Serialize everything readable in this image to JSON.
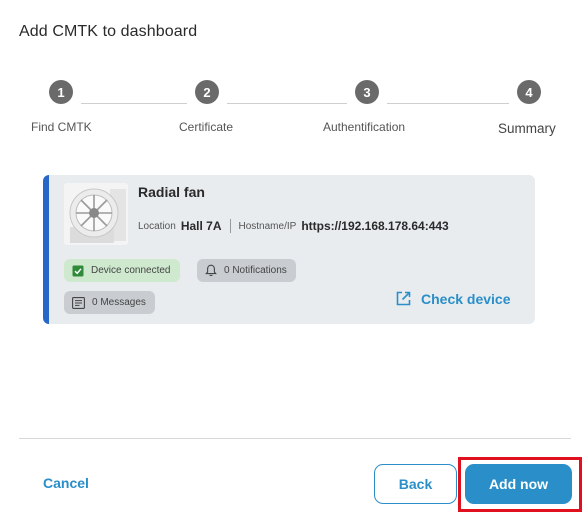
{
  "dialog": {
    "title": "Add CMTK to dashboard"
  },
  "stepper": {
    "steps": [
      {
        "number": "1",
        "label": "Find CMTK"
      },
      {
        "number": "2",
        "label": "Certificate"
      },
      {
        "number": "3",
        "label": "Authentification"
      },
      {
        "number": "4",
        "label": "Summary",
        "active": true
      }
    ]
  },
  "device": {
    "name": "Radial fan",
    "location_label": "Location",
    "location_value": "Hall 7A",
    "hostname_label": "Hostname/IP",
    "hostname_value": "https://192.168.178.64:443",
    "image_icon": "radial-fan-image",
    "chips": {
      "connected": "Device connected",
      "notifications": "0 Notifications",
      "messages": "0 Messages"
    },
    "check_device_label": "Check device"
  },
  "footer": {
    "cancel_label": "Cancel",
    "back_label": "Back",
    "add_label": "Add now"
  },
  "colors": {
    "accent": "#2a8ec8",
    "card_border": "#2867c8",
    "highlight": "#e0101e",
    "connected_bg": "#cfe9cf",
    "step_circle": "#6a6a6a"
  }
}
